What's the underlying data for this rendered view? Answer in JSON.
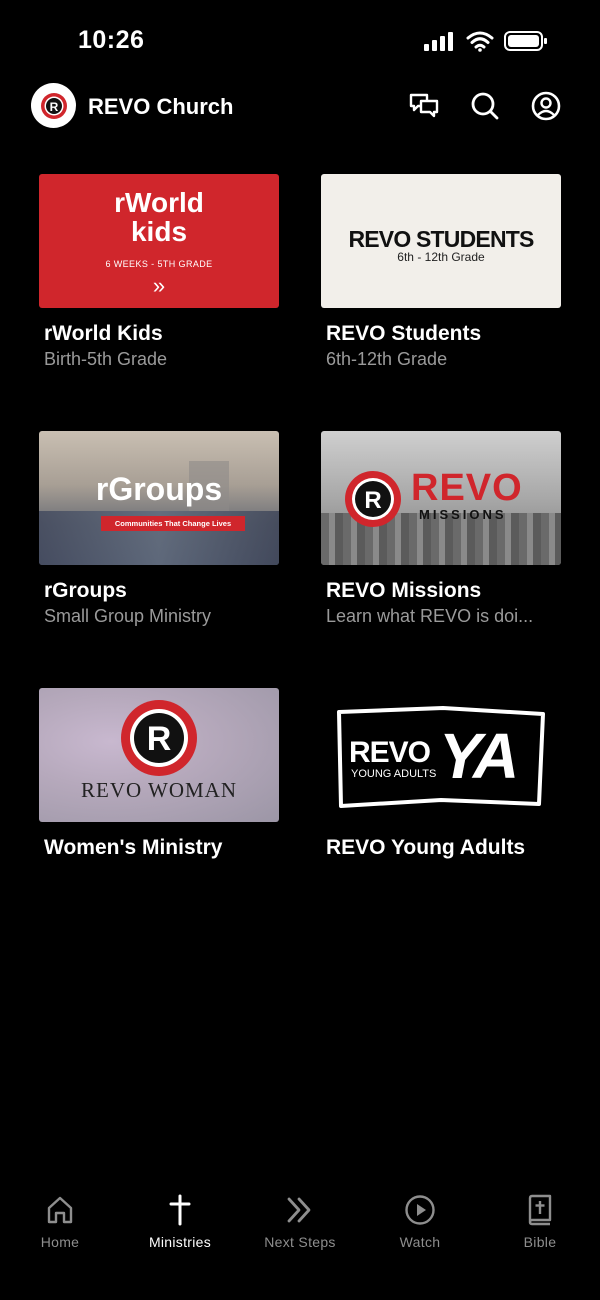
{
  "status": {
    "time": "10:26"
  },
  "header": {
    "title": "REVO Church",
    "logo_letter": "R"
  },
  "ministries": [
    {
      "title": "rWorld Kids",
      "subtitle": "Birth-5th Grade",
      "thumb_line1": "rWorld",
      "thumb_line2": "kids",
      "thumb_sub": "6 WEEKS - 5TH GRADE",
      "thumb_arrow": "»"
    },
    {
      "title": "REVO Students",
      "subtitle": "6th-12th Grade",
      "thumb_line1": "REVO STUDENTS",
      "thumb_sub": "6th - 12th Grade"
    },
    {
      "title": "rGroups",
      "subtitle": "Small Group Ministry",
      "thumb_line1": "rGroups",
      "thumb_banner": "Communities That Change Lives"
    },
    {
      "title": "REVO Missions",
      "subtitle": "Learn what REVO is doi...",
      "thumb_line1": "REVO",
      "thumb_sub": "MISSIONS",
      "thumb_logo": "R"
    },
    {
      "title": "Women's Ministry",
      "subtitle": "",
      "thumb_line1": "REVO WOMAN",
      "thumb_logo": "R"
    },
    {
      "title": "REVO Young Adults",
      "subtitle": "",
      "thumb_line1": "REVO",
      "thumb_sub": "YOUNG ADULTS",
      "thumb_big": "YA"
    }
  ],
  "tabs": [
    {
      "label": "Home",
      "icon": "home-icon",
      "active": false
    },
    {
      "label": "Ministries",
      "icon": "cross-icon",
      "active": true
    },
    {
      "label": "Next Steps",
      "icon": "chevrons-icon",
      "active": false
    },
    {
      "label": "Watch",
      "icon": "play-icon",
      "active": false
    },
    {
      "label": "Bible",
      "icon": "bible-icon",
      "active": false
    }
  ],
  "colors": {
    "accent_red": "#d0262c",
    "background": "#000000",
    "inactive": "#8e8e8e",
    "students_bg": "#f2efea"
  }
}
